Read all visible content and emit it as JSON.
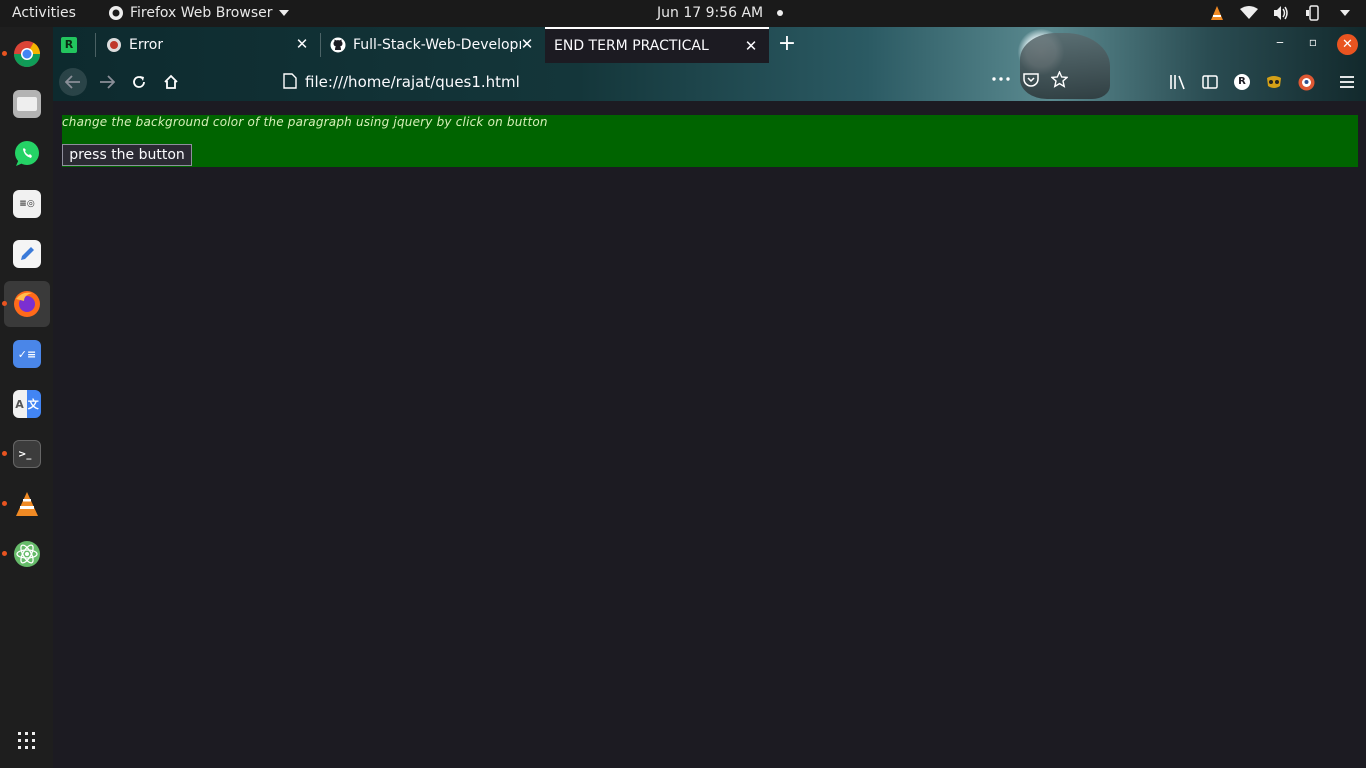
{
  "topbar": {
    "activities": "Activities",
    "app_name": "Firefox Web Browser",
    "clock": "Jun 17   9:56 AM"
  },
  "dock": {
    "items": [
      "chrome",
      "files",
      "whatsapp",
      "document-viewer",
      "text-editor",
      "firefox",
      "tasks",
      "translate",
      "terminal",
      "vlc",
      "atom"
    ]
  },
  "browser": {
    "tabs": [
      {
        "label": "",
        "pinned": true
      },
      {
        "label": "Error"
      },
      {
        "label": "Full-Stack-Web-Developm"
      },
      {
        "label": "END TERM PRACTICAL",
        "selected": true
      }
    ],
    "url": "file:///home/rajat/ques1.html"
  },
  "page": {
    "paragraph": "change the background color of the paragraph using jquery by click on button",
    "button_label": "press the button",
    "paragraph_bg": "#006400"
  },
  "colors": {
    "accent": "#e95420",
    "topbar_bg": "#1a1a1a",
    "page_bg": "#1c1b22"
  }
}
